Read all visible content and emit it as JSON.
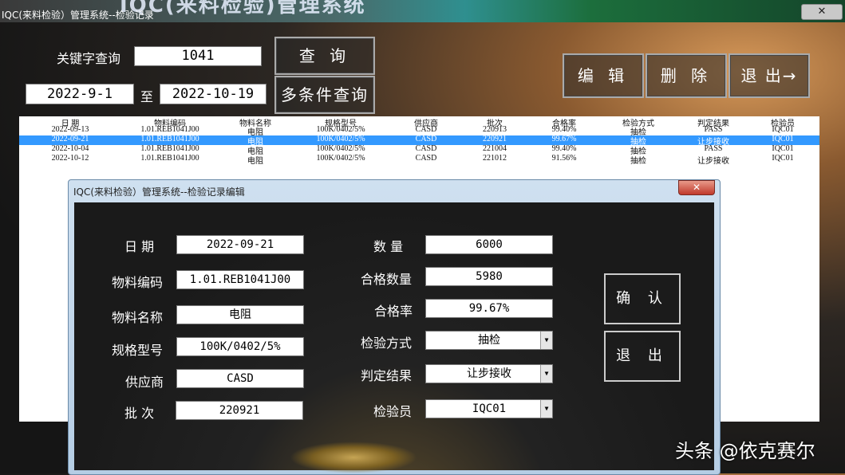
{
  "window": {
    "background_title": "IQC(来料检验)管理系统",
    "title": "IQC(来料检验）管理系统--检验记录",
    "close_icon": "close-icon"
  },
  "search": {
    "keyword_label": "关键字查询",
    "keyword_value": "1041",
    "date_from": "2022-9-1",
    "to_label": "至",
    "date_to": "2022-10-19",
    "query_button": "查 询",
    "multi_query_button": "多条件查询"
  },
  "actions": {
    "edit": "编 辑",
    "delete": "删 除",
    "exit": "退 出→"
  },
  "table": {
    "columns": [
      "日 期",
      "物料编码",
      "物料名称",
      "规格型号",
      "供应商",
      "批次",
      "合格率",
      "检验方式",
      "判定结果",
      "检验员"
    ],
    "rows": [
      [
        "2022-09-13",
        "1.01.REB1041J00",
        "电阻",
        "100K/0402/5%",
        "CASD",
        "220913",
        "99.40%",
        "抽检",
        "PASS",
        "IQC01"
      ],
      [
        "2022-09-21",
        "1.01.REB1041J00",
        "电阻",
        "100K/0402/5%",
        "CASD",
        "220921",
        "99.67%",
        "抽检",
        "让步接收",
        "IQC01"
      ],
      [
        "2022-10-04",
        "1.01.REB1041J00",
        "电阻",
        "100K/0402/5%",
        "CASD",
        "221004",
        "99.40%",
        "抽检",
        "PASS",
        "IQC01"
      ],
      [
        "2022-10-12",
        "1.01.REB1041J00",
        "电阻",
        "100K/0402/5%",
        "CASD",
        "221012",
        "91.56%",
        "抽检",
        "让步接收",
        "IQC01"
      ]
    ],
    "selected_row": 1
  },
  "dialog": {
    "title": "IQC(来料检验）管理系统--检验记录编辑",
    "close_icon": "close-icon",
    "fields": {
      "date_label": "日  期",
      "date_value": "2022-09-21",
      "code_label": "物料编码",
      "code_value": "1.01.REB1041J00",
      "name_label": "物料名称",
      "name_value": "电阻",
      "spec_label": "规格型号",
      "spec_value": "100K/0402/5%",
      "supplier_label": "供应商",
      "supplier_value": "CASD",
      "batch_label": "批  次",
      "batch_value": "220921",
      "qty_label": "数  量",
      "qty_value": "6000",
      "pass_qty_label": "合格数量",
      "pass_qty_value": "5980",
      "pass_rate_label": "合格率",
      "pass_rate_value": "99.67%",
      "method_label": "检验方式",
      "method_value": "抽检",
      "result_label": "判定结果",
      "result_value": "让步接收",
      "inspector_label": "检验员",
      "inspector_value": "IQC01"
    },
    "confirm_button": "确 认",
    "exit_button": "退 出"
  },
  "watermark": "头条 @依克赛尔"
}
